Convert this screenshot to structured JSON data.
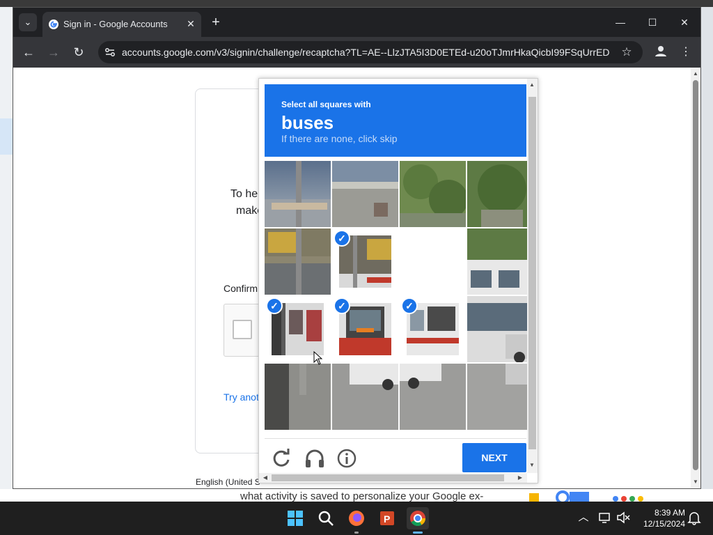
{
  "browser": {
    "tab_title": "Sign in - Google Accounts",
    "url": "accounts.google.com/v3/signin/challenge/recaptcha?TL=AE--LlzJTA5I3D0ETEd-u20oTJmrHkaQicbI99FSqUrrEDQ..."
  },
  "page": {
    "line1": "To hel",
    "line2": "make",
    "confirm": "Confirm",
    "try_another": "Try anot",
    "language": "English (United S"
  },
  "captcha": {
    "instruction": "Select all squares with",
    "target": "buses",
    "hint": "If there are none, click skip",
    "next_label": "NEXT",
    "selected_tiles": [
      5,
      6,
      8,
      9,
      10
    ]
  },
  "background": {
    "text": "what activity is saved to personalize your Google ex-"
  },
  "taskbar": {
    "time": "8:39 AM",
    "date": "12/15/2024"
  },
  "colors": {
    "captcha_blue": "#1a73e8",
    "chrome_dark": "#202124"
  }
}
